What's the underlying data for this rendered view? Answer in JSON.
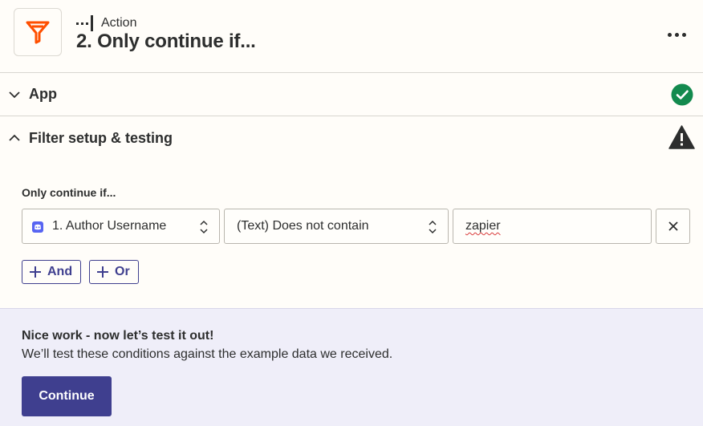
{
  "header": {
    "step_type": "Action",
    "step_title": "2. Only continue if...",
    "app_icon": "filter-icon",
    "more_icon": "more-options-icon"
  },
  "sections": {
    "app": {
      "label": "App",
      "expanded": false,
      "status_icon": "check-circle-icon"
    },
    "filter": {
      "label": "Filter setup & testing",
      "expanded": true,
      "status_icon": "warning-icon"
    }
  },
  "conditions": {
    "title": "Only continue if...",
    "rows": [
      {
        "field_value": "1. Author Username",
        "field_icon": "discord-icon",
        "operator_value": "(Text) Does not contain",
        "value": "zapier",
        "remove_icon": "close-icon"
      }
    ],
    "and_label": "And",
    "or_label": "Or"
  },
  "test": {
    "title": "Nice work - now let’s test it out!",
    "description": "We’ll test these conditions against the example data we received.",
    "continue_label": "Continue"
  },
  "colors": {
    "brand_orange": "#ff4f00",
    "accent": "#3f3f8f",
    "success": "#138a4e",
    "panel_bg": "#efeef9",
    "page_bg": "#fffdf9"
  }
}
